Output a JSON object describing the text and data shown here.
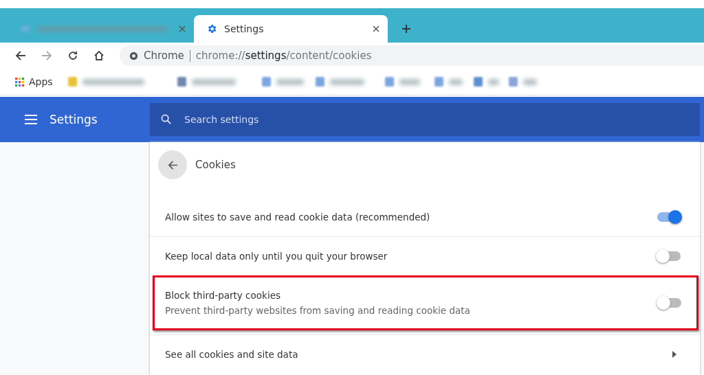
{
  "tabs": [
    {
      "selected": false
    },
    {
      "title": "Settings",
      "selected": true
    }
  ],
  "address_bar": {
    "site": "Chrome",
    "url": "chrome://**settings**/content/cookies"
  },
  "bookmarks": [
    {
      "label": "Apps"
    }
  ],
  "header": {
    "title": "Settings",
    "search_placeholder": "Search settings"
  },
  "page": {
    "title": "Cookies"
  },
  "rows": [
    {
      "kind": "toggle",
      "label": "Allow sites to save and read cookie data (recommended)",
      "on": true,
      "highlighted": false
    },
    {
      "kind": "toggle",
      "label": "Keep local data only until you quit your browser",
      "on": false,
      "highlighted": false
    },
    {
      "kind": "toggle",
      "label": "Block third-party cookies",
      "description": "Prevent third-party websites from saving and reading cookie data",
      "on": false,
      "highlighted": true
    },
    {
      "kind": "link",
      "label": "See all cookies and site data",
      "highlighted": false
    }
  ]
}
